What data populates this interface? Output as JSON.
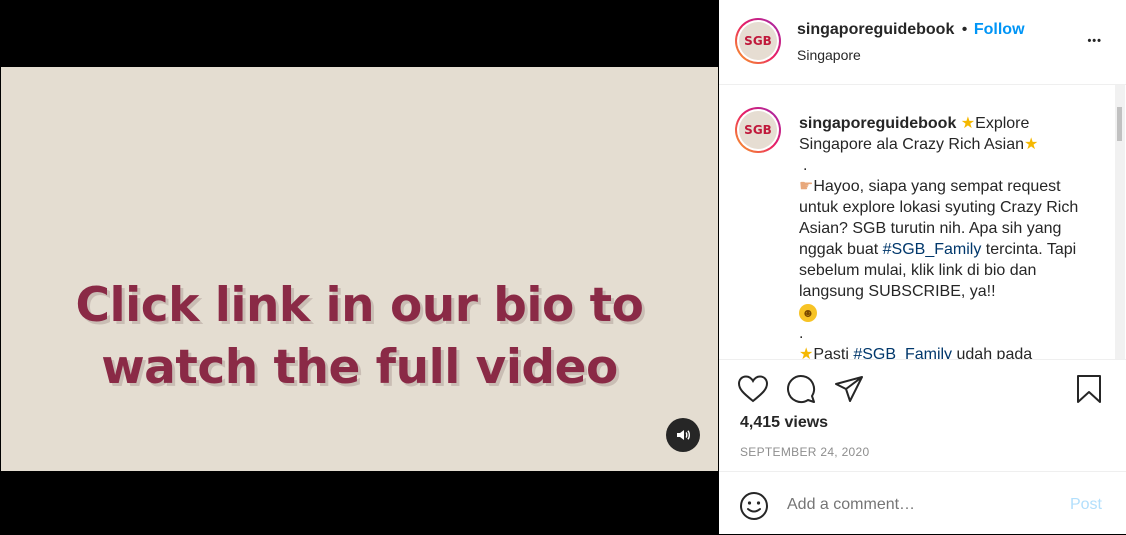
{
  "video": {
    "line1": "Click link in our bio to",
    "line2": "watch the full video"
  },
  "header": {
    "username": "singaporeguidebook",
    "separator": "•",
    "follow_label": "Follow",
    "location": "Singapore",
    "more": "•••",
    "avatar_text": "SGB"
  },
  "caption": {
    "username": "singaporeguidebook",
    "intro": "Explore Singapore ala Crazy Rich Asian",
    "dot1": ".",
    "para1_a": "Hayoo, siapa yang sempat request untuk explore lokasi syuting Crazy Rich Asian? SGB turutin nih. Apa sih yang nggak buat ",
    "hashtag1": "#SGB_Family",
    "para1_b": " tercinta. Tapi sebelum mulai, klik link di bio dan langsung SUBSCRIBE, ya!!",
    "dot2": ".",
    "para2_a": "Pasti ",
    "hashtag2": "#SGB_Family",
    "para2_b": " udah pada"
  },
  "stats": {
    "views": "4,415 views",
    "date": "SEPTEMBER 24, 2020"
  },
  "comment_box": {
    "placeholder": "Add a comment…",
    "post_label": "Post"
  },
  "icons": {
    "like": "heart-icon",
    "comment": "comment-icon",
    "share": "share-icon",
    "save": "bookmark-icon",
    "emoji": "emoji-icon",
    "mute": "speaker-icon"
  },
  "colors": {
    "follow": "#0095f6",
    "hashtag": "#00376b",
    "video_bg": "#e4ddd1",
    "video_text": "#8a2a46"
  }
}
